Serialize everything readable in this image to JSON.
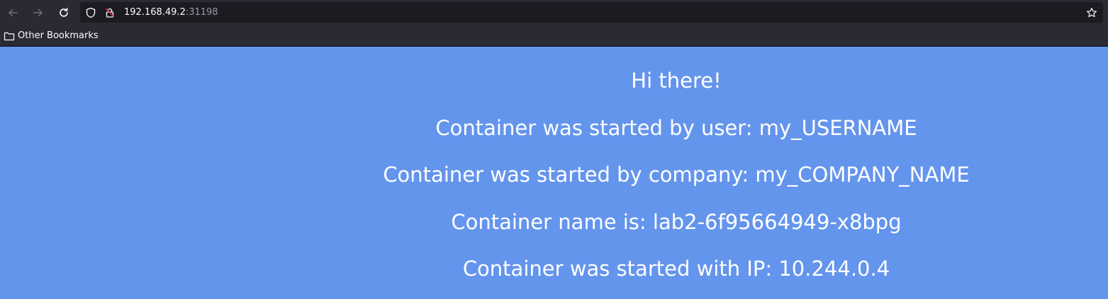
{
  "browser": {
    "url_host": "192.168.49.2",
    "url_port": ":31198",
    "bookmarks": [
      {
        "label": "Other Bookmarks",
        "icon": "folder-icon"
      }
    ]
  },
  "page": {
    "background": "#6495ed",
    "lines": [
      "Hi there!",
      "Container was started by user: my_USERNAME",
      "Container was started by company: my_COMPANY_NAME",
      "Container name is: lab2-6f95664949-x8bpg",
      "Container was started with IP: 10.244.0.4"
    ]
  }
}
